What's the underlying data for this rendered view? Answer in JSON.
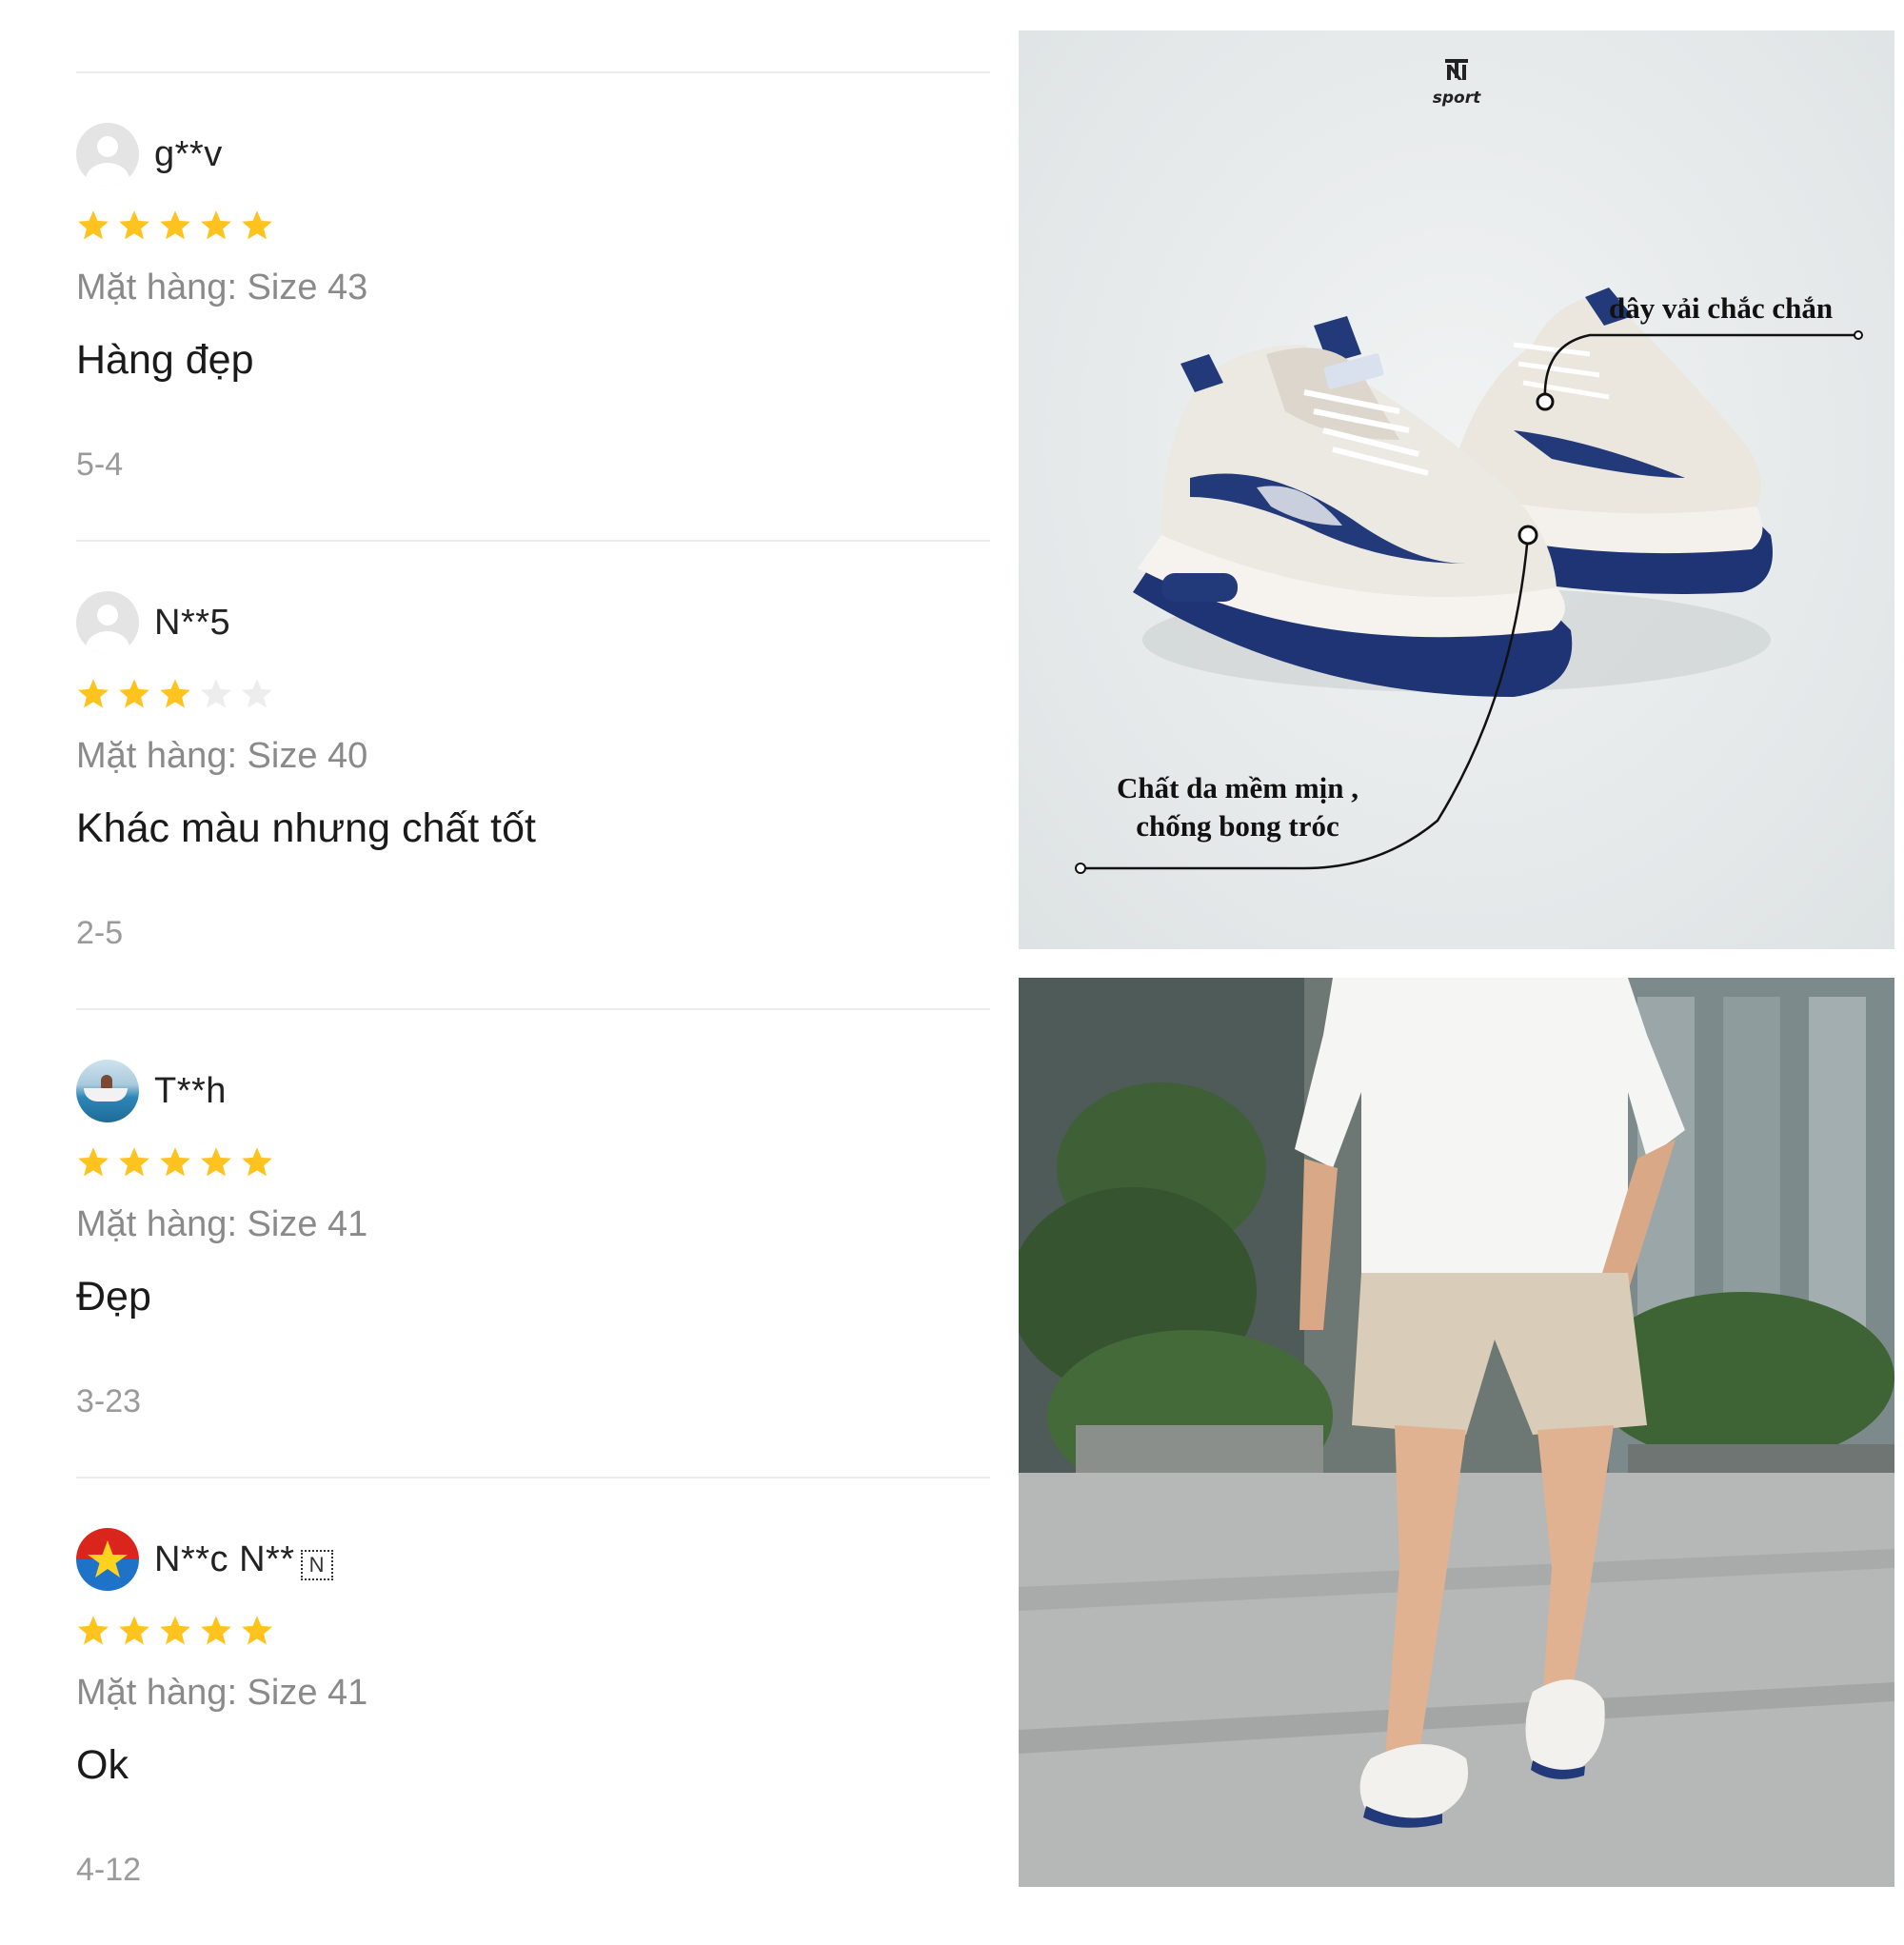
{
  "reviews": [
    {
      "username": "g**v",
      "avatar": "default-avatar",
      "rating": 5,
      "variant": "Mặt hàng: Size 43",
      "comment": "Hàng đẹp",
      "date": "5-4"
    },
    {
      "username": "N**5",
      "avatar": "default-avatar",
      "rating": 3,
      "variant": "Mặt hàng: Size 40",
      "comment": "Khác màu nhưng chất tốt",
      "date": "2-5"
    },
    {
      "username": "T**h",
      "avatar": "photo-avatar",
      "rating": 5,
      "variant": "Mặt hàng: Size 41",
      "comment": "Đẹp",
      "date": "3-23"
    },
    {
      "username": "N**c N**",
      "name_badge": "N",
      "avatar": "flag-avatar",
      "rating": 5,
      "variant": "Mặt hàng: Size 41",
      "comment": "Ok",
      "date": "4-12"
    }
  ],
  "product_image": {
    "brand": "sport",
    "callout_lace": "dây vải chắc chắn",
    "callout_leather_line1": "Chất da  mềm mịn ,",
    "callout_leather_line2": "chống bong tróc"
  },
  "colors": {
    "star_filled": "#FFC31F",
    "star_empty": "#EDEDED",
    "shoe_navy": "#233a7a",
    "shoe_cream": "#ece8e2"
  }
}
